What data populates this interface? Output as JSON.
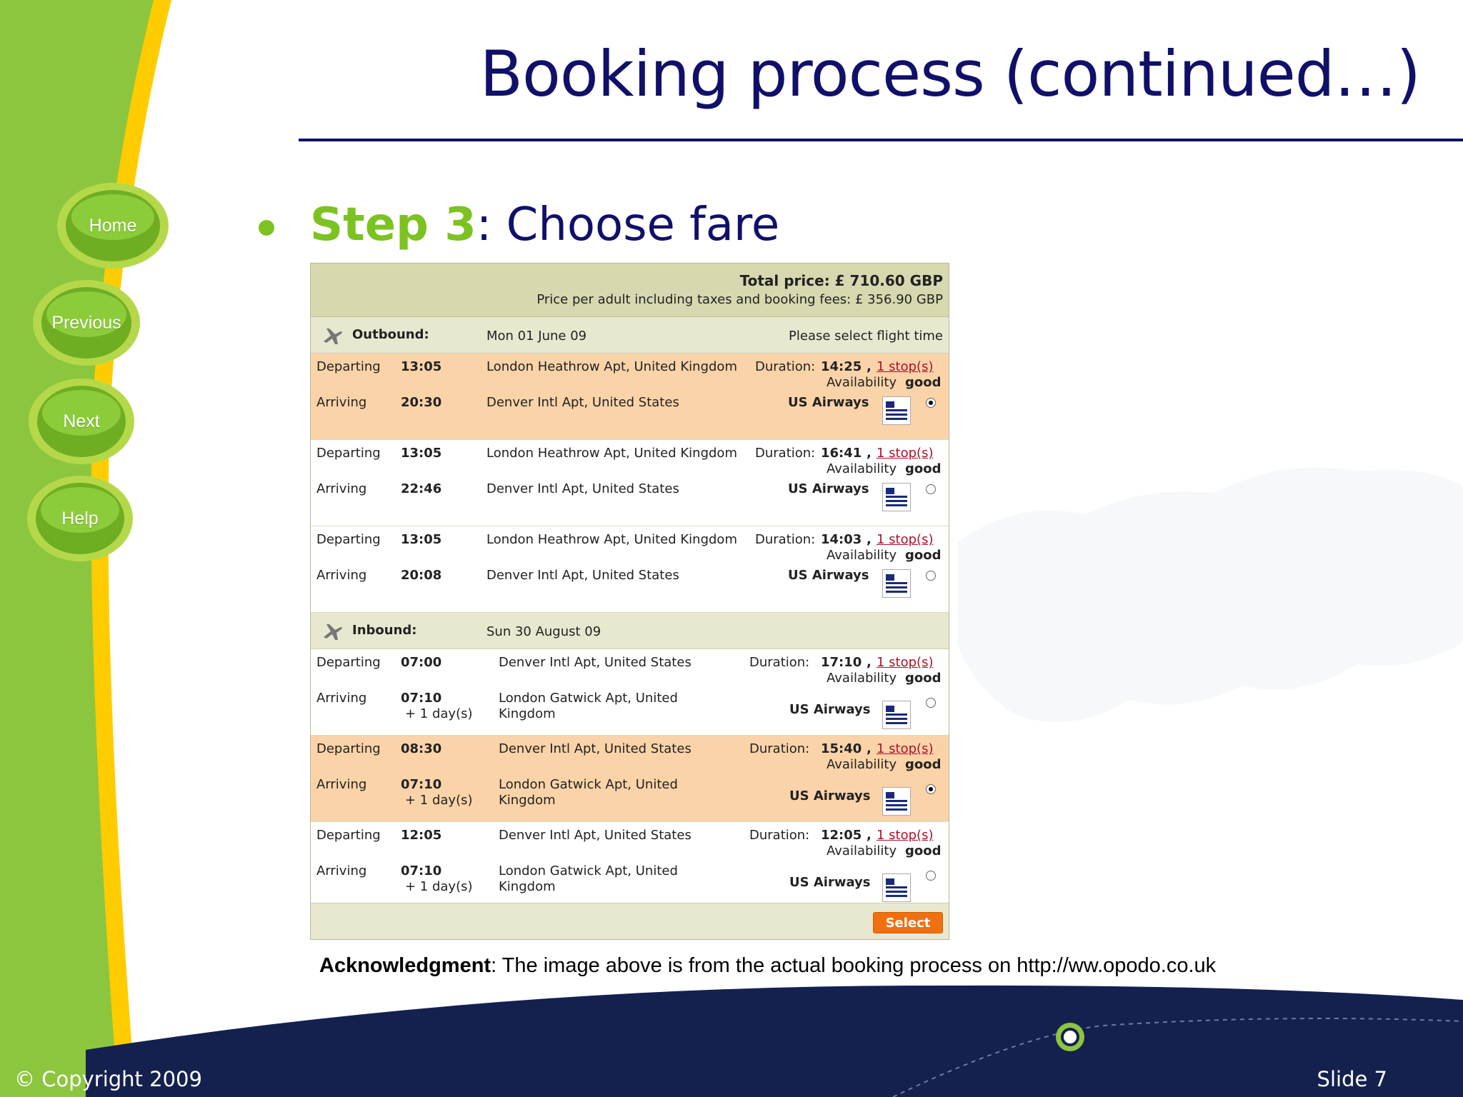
{
  "slide": {
    "title": "Booking process (continued…)",
    "step_label": "Step 3",
    "step_text": ": Choose fare",
    "copyright": "© Copyright 2009",
    "slide_number": "Slide 7",
    "acknowledgment_label": "Acknowledgment",
    "acknowledgment_text": ": The image above is from the actual booking process on http://ww.opodo.co.uk"
  },
  "nav": [
    {
      "label": "Home"
    },
    {
      "label": "Previous"
    },
    {
      "label": "Next"
    },
    {
      "label": "Help"
    }
  ],
  "colors": {
    "title": "#10106a",
    "accent_green": "#7cc221",
    "footer_navy": "#14214f",
    "selected_row": "#fad3a8",
    "select_button": "#f07010"
  },
  "booking": {
    "total_price": "Total price: £ 710.60 GBP",
    "price_per_adult": "Price per adult including taxes and booking fees: £ 356.90 GBP",
    "outbound": {
      "label": "Outbound:",
      "date": "Mon 01 June 09",
      "hint": "Please select flight time",
      "flights": [
        {
          "dep_label": "Departing",
          "dep_time": "13:05",
          "dep_airport": "London Heathrow Apt, United Kingdom",
          "duration_label": "Duration:",
          "duration": "14:25",
          "stops": "1 stop(s)",
          "availability_label": "Availability",
          "availability": "good",
          "arr_label": "Arriving",
          "arr_time": "20:30",
          "arr_airport": "Denver Intl Apt, United States",
          "airline": "US Airways",
          "selected": true
        },
        {
          "dep_label": "Departing",
          "dep_time": "13:05",
          "dep_airport": "London Heathrow Apt, United Kingdom",
          "duration_label": "Duration:",
          "duration": "16:41",
          "stops": "1 stop(s)",
          "availability_label": "Availability",
          "availability": "good",
          "arr_label": "Arriving",
          "arr_time": "22:46",
          "arr_airport": "Denver Intl Apt, United States",
          "airline": "US Airways",
          "selected": false
        },
        {
          "dep_label": "Departing",
          "dep_time": "13:05",
          "dep_airport": "London Heathrow Apt, United Kingdom",
          "duration_label": "Duration:",
          "duration": "14:03",
          "stops": "1 stop(s)",
          "availability_label": "Availability",
          "availability": "good",
          "arr_label": "Arriving",
          "arr_time": "20:08",
          "arr_airport": "Denver Intl Apt, United States",
          "airline": "US Airways",
          "selected": false
        }
      ]
    },
    "inbound": {
      "label": "Inbound:",
      "date": "Sun 30 August 09",
      "flights": [
        {
          "dep_label": "Departing",
          "dep_time": "07:00",
          "dep_airport": "Denver Intl Apt, United States",
          "duration_label": "Duration:",
          "duration": "17:10",
          "stops": "1 stop(s)",
          "availability_label": "Availability",
          "availability": "good",
          "arr_label": "Arriving",
          "arr_time": "07:10",
          "arr_extra": "+ 1 day(s)",
          "arr_airport_1": "London Gatwick Apt, United",
          "arr_airport_2": "Kingdom",
          "airline": "US Airways",
          "selected": false
        },
        {
          "dep_label": "Departing",
          "dep_time": "08:30",
          "dep_airport": "Denver Intl Apt, United States",
          "duration_label": "Duration:",
          "duration": "15:40",
          "stops": "1 stop(s)",
          "availability_label": "Availability",
          "availability": "good",
          "arr_label": "Arriving",
          "arr_time": "07:10",
          "arr_extra": "+ 1 day(s)",
          "arr_airport_1": "London Gatwick Apt, United",
          "arr_airport_2": "Kingdom",
          "airline": "US Airways",
          "selected": true
        },
        {
          "dep_label": "Departing",
          "dep_time": "12:05",
          "dep_airport": "Denver Intl Apt, United States",
          "duration_label": "Duration:",
          "duration": "12:05",
          "stops": "1 stop(s)",
          "availability_label": "Availability",
          "availability": "good",
          "arr_label": "Arriving",
          "arr_time": "07:10",
          "arr_extra": "+ 1 day(s)",
          "arr_airport_1": "London Gatwick Apt, United",
          "arr_airport_2": "Kingdom",
          "airline": "US Airways",
          "selected": false
        }
      ]
    },
    "select_label": "Select"
  }
}
